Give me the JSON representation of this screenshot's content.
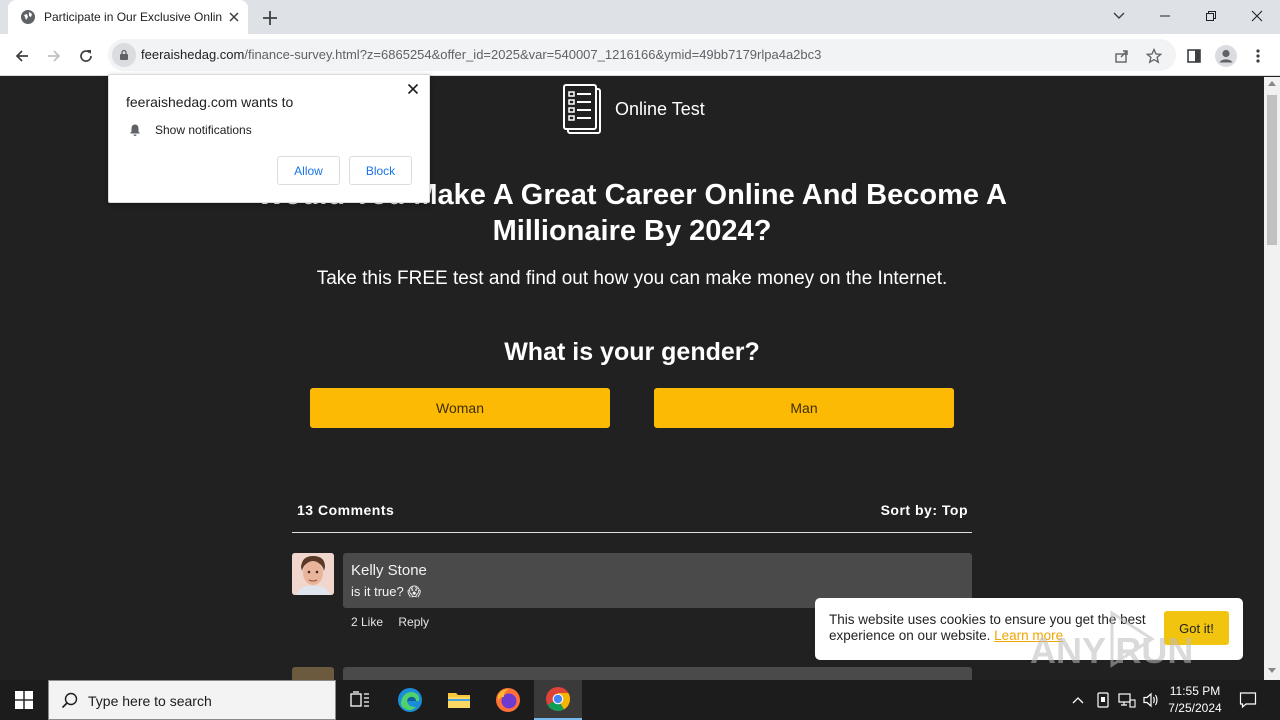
{
  "browser": {
    "tab_title": "Participate in Our Exclusive Online",
    "url_host": "feeraishedag.com",
    "url_path": "/finance-survey.html?z=6865254&offer_id=2025&var=540007_1216166&ymid=49bb7179rlpa4a2bc3"
  },
  "notification_prompt": {
    "site": "feeraishedag.com wants to",
    "permission": "Show notifications",
    "allow_label": "Allow",
    "block_label": "Block"
  },
  "page": {
    "brand_name": "Online Test",
    "headline": "Would You Make A Great Career Online And Become A Millionaire By 2024?",
    "subline": "Take this FREE test and find out how you can make money on the Internet.",
    "question": "What is your gender?",
    "choices": [
      "Woman",
      "Man"
    ],
    "choice_color": "#fdba04",
    "comments": {
      "count_label": "13 Comments",
      "sort_label": "Sort by: Top",
      "items": [
        {
          "author": "Kelly Stone",
          "text": "is it true? 😱",
          "likes": "2 Like",
          "reply": "Reply"
        }
      ]
    }
  },
  "cookie_banner": {
    "message": "This website uses cookies to ensure you get the best experience on our website.",
    "link": "Learn more",
    "button": "Got it!"
  },
  "watermark": "ANY RUN",
  "taskbar": {
    "search_placeholder": "Type here to search",
    "time": "11:55 PM",
    "date": "7/25/2024"
  }
}
